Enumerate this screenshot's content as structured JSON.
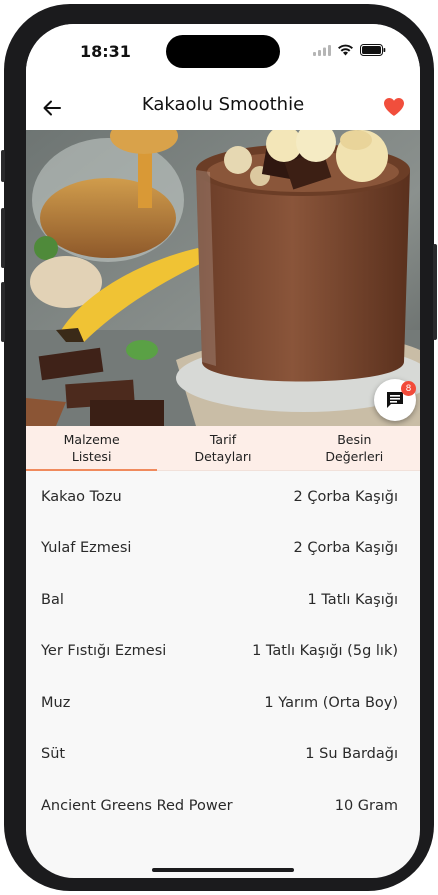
{
  "status_bar": {
    "time": "18:31"
  },
  "header": {
    "title": "Kakaolu Smoothie",
    "back_icon": "arrow-left-icon",
    "favorite_icon": "heart-icon",
    "favorite_color": "#f14e3c"
  },
  "chat": {
    "icon": "chat-icon",
    "badge": "8"
  },
  "tabs": [
    {
      "label": "Malzeme\nListesi",
      "active": true
    },
    {
      "label": "Tarif\nDetayları",
      "active": false
    },
    {
      "label": "Besin\nDeğerleri",
      "active": false
    }
  ],
  "accent_color": "#f08a5d",
  "ingredients": [
    {
      "name": "Kakao Tozu",
      "amount": "2 Çorba Kaşığı"
    },
    {
      "name": "Yulaf Ezmesi",
      "amount": "2 Çorba Kaşığı"
    },
    {
      "name": "Bal",
      "amount": "1 Tatlı Kaşığı"
    },
    {
      "name": "Yer Fıstığı Ezmesi",
      "amount": "1 Tatlı Kaşığı (5g lık)"
    },
    {
      "name": "Muz",
      "amount": "1 Yarım (Orta Boy)"
    },
    {
      "name": "Süt",
      "amount": "1 Su Bardağı"
    },
    {
      "name": "Ancient Greens Red Power",
      "amount": "10 Gram"
    }
  ]
}
